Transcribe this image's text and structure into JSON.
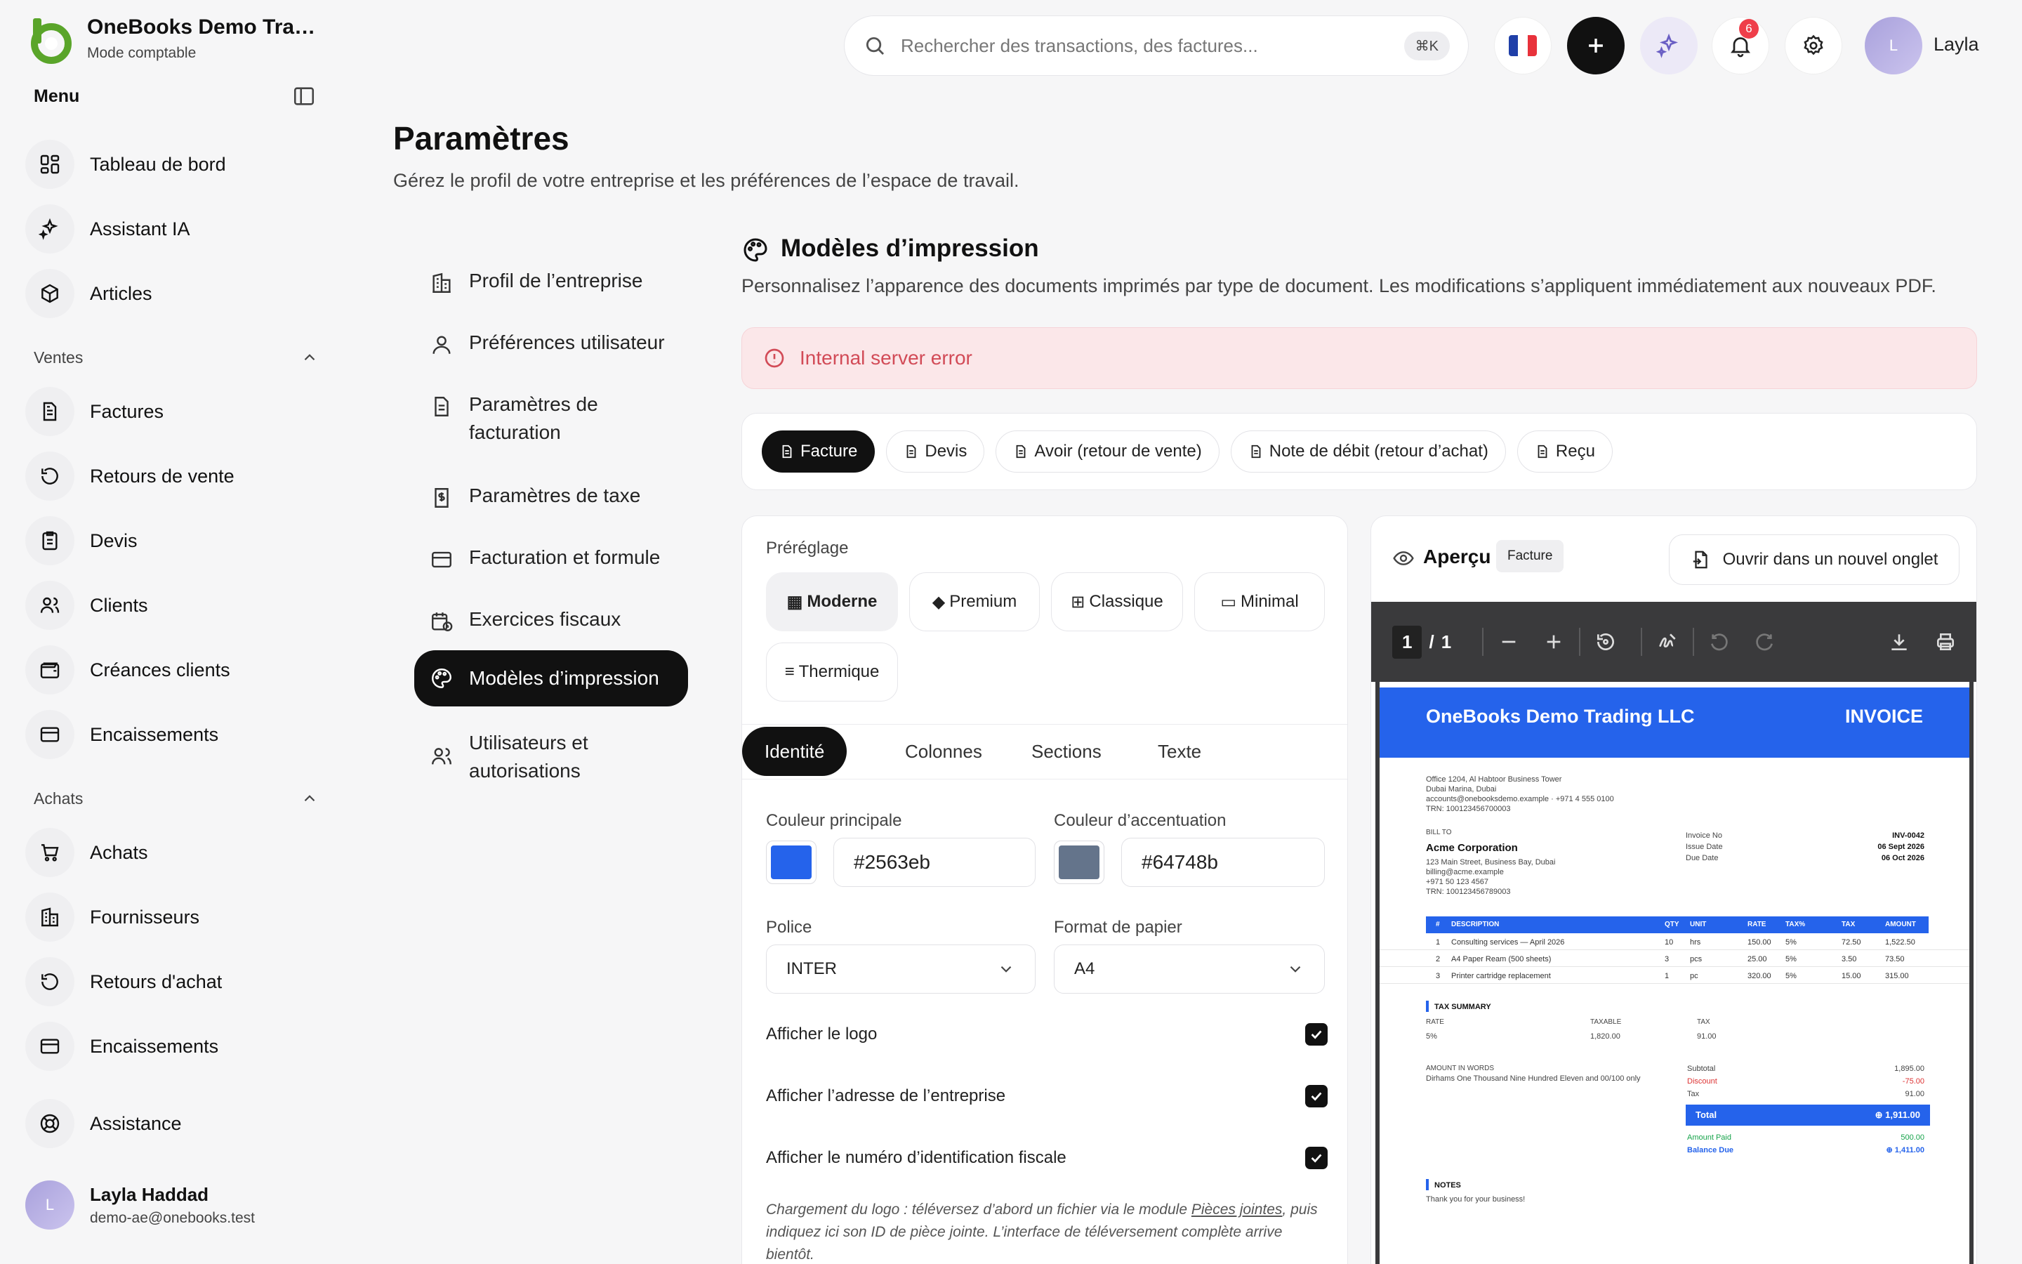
{
  "brand": {
    "name": "OneBooks Demo Tradin...",
    "mode": "Mode comptable"
  },
  "sidebar": {
    "menu_title": "Menu",
    "items_main": [
      {
        "label": "Tableau de bord",
        "icon": "dashboard-icon"
      },
      {
        "label": "Assistant IA",
        "icon": "sparkles-icon"
      },
      {
        "label": "Articles",
        "icon": "package-icon"
      }
    ],
    "sales_title": "Ventes",
    "items_sales": [
      {
        "label": "Factures",
        "icon": "invoice-icon"
      },
      {
        "label": "Retours de vente",
        "icon": "return-icon"
      },
      {
        "label": "Devis",
        "icon": "quote-icon"
      },
      {
        "label": "Clients",
        "icon": "users-icon"
      },
      {
        "label": "Créances clients",
        "icon": "wallet-icon"
      },
      {
        "label": "Encaissements",
        "icon": "card-icon"
      }
    ],
    "purchases_title": "Achats",
    "items_purchases": [
      {
        "label": "Achats",
        "icon": "cart-icon"
      },
      {
        "label": "Fournisseurs",
        "icon": "building-icon"
      },
      {
        "label": "Retours d'achat",
        "icon": "return-icon"
      },
      {
        "label": "Encaissements",
        "icon": "card-icon"
      }
    ],
    "support": {
      "label": "Assistance",
      "icon": "lifebuoy-icon"
    },
    "user": {
      "initial": "L",
      "name": "Layla Haddad",
      "email": "demo-ae@onebooks.test"
    }
  },
  "topbar": {
    "search_placeholder": "Rechercher des transactions, des factures...",
    "shortcut": "⌘K",
    "notifications_count": "6",
    "user_initial": "L",
    "user_name": "Layla",
    "flag_colors": [
      "#1f3fa8",
      "#ffffff",
      "#e8323b"
    ]
  },
  "page": {
    "title": "Paramètres",
    "subtitle": "Gérez le profil de votre entreprise et les préférences de l’espace de travail."
  },
  "settings_nav": [
    {
      "label": "Profil de l’entreprise",
      "icon": "building-icon"
    },
    {
      "label": "Préférences utilisateur",
      "icon": "user-icon"
    },
    {
      "label": "Paramètres de facturation",
      "icon": "document-icon"
    },
    {
      "label": "Paramètres de taxe",
      "icon": "tax-icon"
    },
    {
      "label": "Facturation et formule",
      "icon": "card-icon"
    },
    {
      "label": "Exercices fiscaux",
      "icon": "calendar-icon"
    },
    {
      "label": "Modèles d’impression",
      "icon": "palette-icon",
      "active": true
    },
    {
      "label": "Utilisateurs et autorisations",
      "icon": "users-icon"
    }
  ],
  "section": {
    "title": "Modèles d’impression",
    "description": "Personnalisez l’apparence des documents imprimés par type de document. Les modifications s’appliquent immédiatement aux nouveaux PDF.",
    "error": "Internal server error"
  },
  "doc_tabs": [
    "Facture",
    "Devis",
    "Avoir (retour de vente)",
    "Note de débit (retour d’achat)",
    "Reçu"
  ],
  "editor": {
    "preset_label": "Préréglage",
    "presets": [
      {
        "label": "Moderne",
        "glyph": "▦"
      },
      {
        "label": "Premium",
        "glyph": "◆"
      },
      {
        "label": "Classique",
        "glyph": "⊞"
      },
      {
        "label": "Minimal",
        "glyph": "▭"
      },
      {
        "label": "Thermique",
        "glyph": "≡"
      }
    ],
    "tabs": [
      "Identité",
      "Colonnes",
      "Sections",
      "Texte"
    ],
    "primary_color_label": "Couleur principale",
    "primary_color": "#2563eb",
    "accent_color_label": "Couleur d’accentuation",
    "accent_color": "#64748b",
    "font_label": "Police",
    "font_value": "INTER",
    "paper_label": "Format de papier",
    "paper_value": "A4",
    "checkboxes": [
      {
        "label": "Afficher le logo",
        "checked": true
      },
      {
        "label": "Afficher l’adresse de l’entreprise",
        "checked": true
      },
      {
        "label": "Afficher le numéro d’identification fiscale",
        "checked": true
      }
    ],
    "note_before": "Chargement du logo : téléversez d’abord un fichier via le module ",
    "note_link": "Pièces jointes",
    "note_after": ", puis indiquez ici son ID de pièce jointe. L’interface de téléversement complète arrive bientôt."
  },
  "preview": {
    "title": "Aperçu",
    "chip": "Facture",
    "open_label": "Ouvrir dans un nouvel onglet",
    "page_current": "1",
    "page_sep": "/",
    "page_total": "1"
  },
  "invoice": {
    "company": "OneBooks Demo Trading LLC",
    "doc_title": "INVOICE",
    "address": [
      "Office 1204, Al Habtoor Business Tower",
      "Dubai Marina, Dubai",
      "accounts@onebooksdemo.example · +971 4 555 0100",
      "TRN: 100123456700003"
    ],
    "bill_to_label": "BILL TO",
    "customer": "Acme Corporation",
    "customer_lines": [
      "123 Main Street, Business Bay, Dubai",
      "billing@acme.example",
      "+971 50 123 4567",
      "TRN: 100123456789003"
    ],
    "meta_labels": [
      "Invoice No",
      "Issue Date",
      "Due Date"
    ],
    "meta_values": [
      "INV-0042",
      "06 Sept 2026",
      "06 Oct 2026"
    ],
    "columns": [
      "#",
      "DESCRIPTION",
      "QTY",
      "UNIT",
      "RATE",
      "TAX%",
      "TAX",
      "AMOUNT"
    ],
    "rows": [
      [
        "1",
        "Consulting services — April 2026",
        "10",
        "hrs",
        "150.00",
        "5%",
        "72.50",
        "1,522.50"
      ],
      [
        "2",
        "A4 Paper Ream (500 sheets)",
        "3",
        "pcs",
        "25.00",
        "5%",
        "3.50",
        "73.50"
      ],
      [
        "3",
        "Printer cartridge replacement",
        "1",
        "pc",
        "320.00",
        "5%",
        "15.00",
        "315.00"
      ]
    ],
    "tax_summary_title": "TAX SUMMARY",
    "tax_cols": [
      "RATE",
      "TAXABLE",
      "TAX"
    ],
    "tax_vals": [
      "5%",
      "1,820.00",
      "91.00"
    ],
    "words_label": "AMOUNT IN WORDS",
    "words": "Dirhams One Thousand Nine Hundred Eleven and 00/100 only",
    "subtotal_label": "Subtotal",
    "subtotal": "1,895.00",
    "discount_label": "Discount",
    "discount": "-75.00",
    "tax_label": "Tax",
    "tax": "91.00",
    "total_label": "Total",
    "total": "⊕ 1,911.00",
    "paid_label": "Amount Paid",
    "paid": "500.00",
    "balance_label": "Balance Due",
    "balance": "⊕ 1,411.00",
    "notes_title": "NOTES",
    "notes": "Thank you for your business!"
  }
}
